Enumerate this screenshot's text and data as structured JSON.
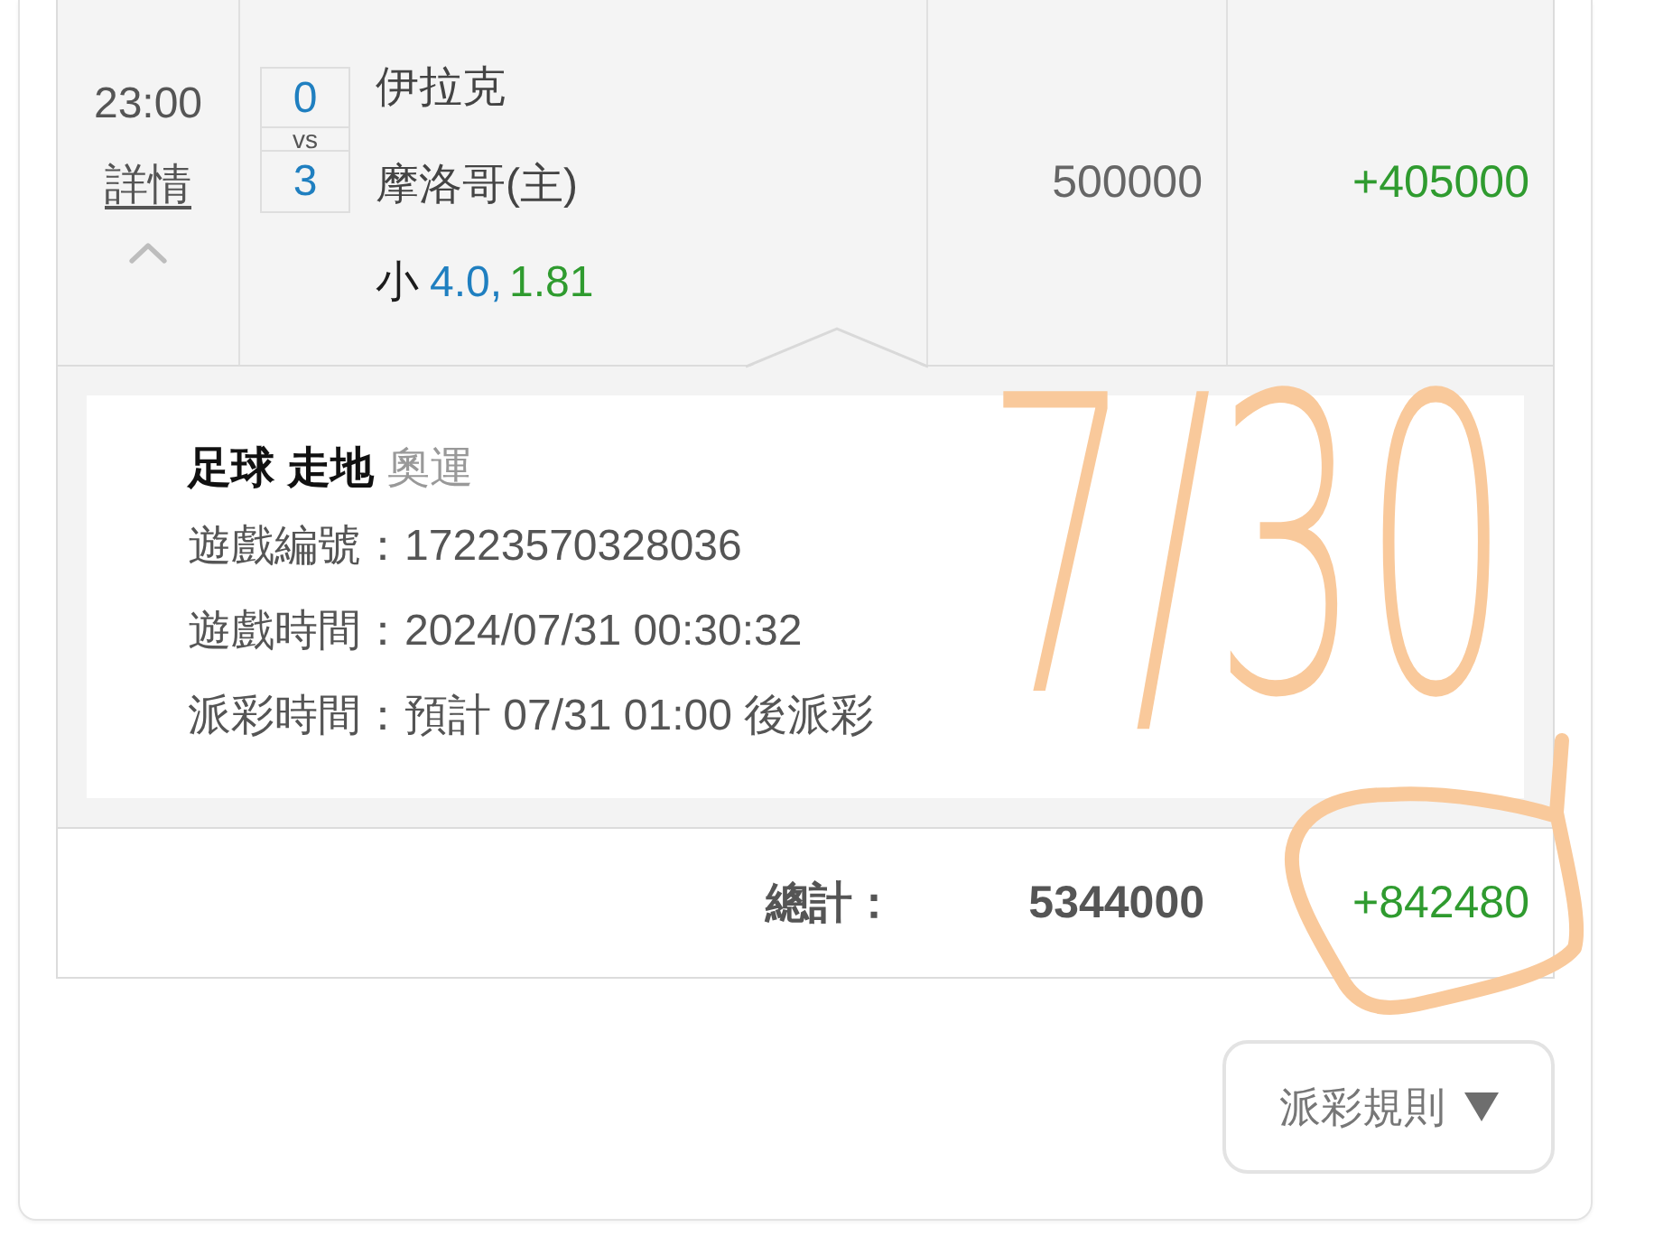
{
  "bet_row": {
    "time": "23:00",
    "details_link": "詳情",
    "expanded": true,
    "score": [
      "0",
      "3"
    ],
    "score_separator": "vs",
    "teams": [
      "伊拉克",
      "摩洛哥(主)"
    ],
    "bet": {
      "selection": "小",
      "line": "4.0,",
      "odds": "1.81"
    },
    "stake": "500000",
    "result": "+405000"
  },
  "detail": {
    "sport": "足球",
    "market": "走地",
    "event": "奧運",
    "lines": [
      "遊戲編號：17223570328036",
      "遊戲時間：2024/07/31 00:30:32",
      "派彩時間：預計 07/31 01:00 後派彩"
    ]
  },
  "total": {
    "label": "總計：",
    "stake": "5344000",
    "result": "+842480"
  },
  "rules_button": {
    "label": "派彩規則"
  },
  "annotation": {
    "text": "7/30",
    "circles_total": true
  }
}
